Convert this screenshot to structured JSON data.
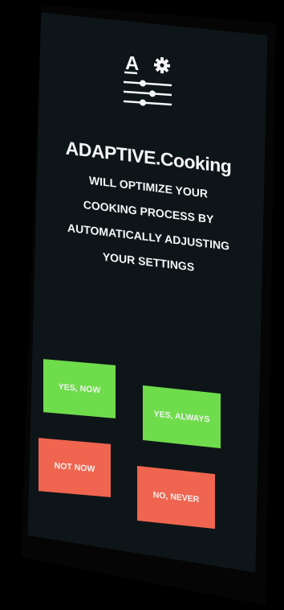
{
  "header": {
    "icon": "adaptive-settings-icon",
    "icon_letter": "A"
  },
  "dialog": {
    "title": "ADAPTIVE.Cooking",
    "description_lines": [
      "WILL OPTIMIZE YOUR",
      "COOKING PROCESS BY",
      "AUTOMATICALLY ADJUSTING",
      "YOUR SETTINGS"
    ]
  },
  "buttons": {
    "yes_now": "YES, NOW",
    "yes_always": "YES, ALWAYS",
    "not_now": "NOT NOW",
    "no_never": "NO, NEVER"
  },
  "colors": {
    "background": "#0e1518",
    "text": "#f4f6f7",
    "accept": "#6fdc4c",
    "decline": "#f0654f"
  }
}
